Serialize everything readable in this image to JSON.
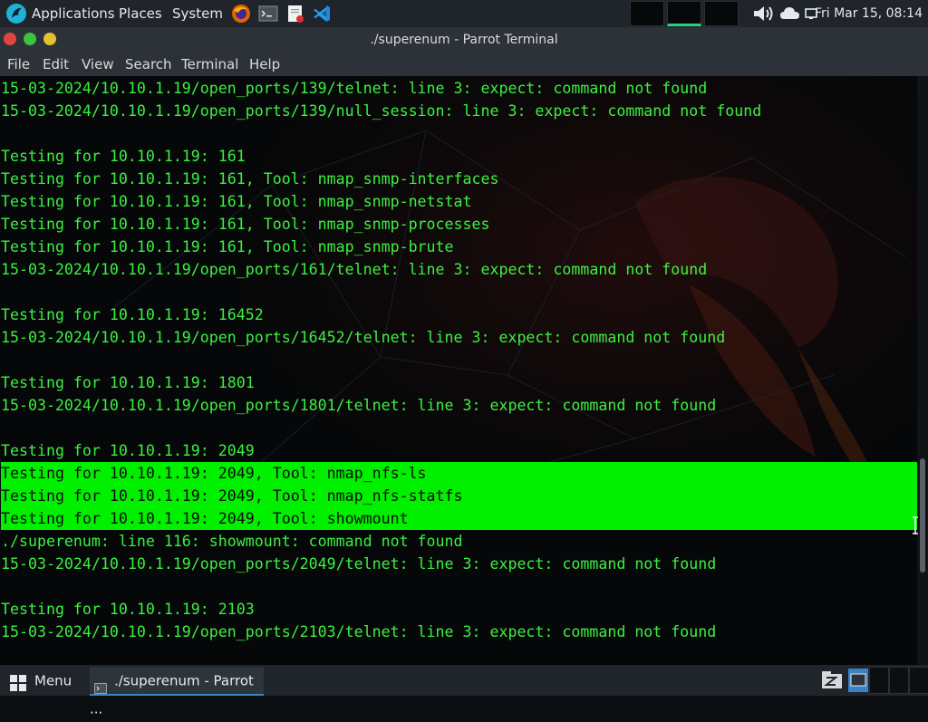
{
  "top_panel": {
    "applications_label": "Applications",
    "places_label": "Places",
    "system_label": "System",
    "launchers": [
      "firefox-icon",
      "terminal-icon",
      "text-editor-icon",
      "vscode-icon"
    ],
    "clock": "Fri Mar 15, 08:14"
  },
  "window": {
    "title": "./superenum - Parrot Terminal",
    "menu": {
      "file": "File",
      "edit": "Edit",
      "view": "View",
      "search": "Search",
      "terminal": "Terminal",
      "help": "Help"
    }
  },
  "terminal": {
    "text_color": "#3cf040",
    "selection_color": "#00f000",
    "lines": [
      {
        "text": "15-03-2024/10.10.1.19/open_ports/139/telnet: line 3: expect: command not found",
        "selected": false
      },
      {
        "text": "15-03-2024/10.10.1.19/open_ports/139/null_session: line 3: expect: command not found",
        "selected": false
      },
      {
        "text": "",
        "selected": false
      },
      {
        "text": "Testing for 10.10.1.19: 161",
        "selected": false
      },
      {
        "text": "Testing for 10.10.1.19: 161, Tool: nmap_snmp-interfaces",
        "selected": false
      },
      {
        "text": "Testing for 10.10.1.19: 161, Tool: nmap_snmp-netstat",
        "selected": false
      },
      {
        "text": "Testing for 10.10.1.19: 161, Tool: nmap_snmp-processes",
        "selected": false
      },
      {
        "text": "Testing for 10.10.1.19: 161, Tool: nmap_snmp-brute",
        "selected": false
      },
      {
        "text": "15-03-2024/10.10.1.19/open_ports/161/telnet: line 3: expect: command not found",
        "selected": false
      },
      {
        "text": "",
        "selected": false
      },
      {
        "text": "Testing for 10.10.1.19: 16452",
        "selected": false
      },
      {
        "text": "15-03-2024/10.10.1.19/open_ports/16452/telnet: line 3: expect: command not found",
        "selected": false
      },
      {
        "text": "",
        "selected": false
      },
      {
        "text": "Testing for 10.10.1.19: 1801",
        "selected": false
      },
      {
        "text": "15-03-2024/10.10.1.19/open_ports/1801/telnet: line 3: expect: command not found",
        "selected": false
      },
      {
        "text": "",
        "selected": false
      },
      {
        "text": "Testing for 10.10.1.19: 2049",
        "selected": false
      },
      {
        "text": "Testing for 10.10.1.19: 2049, Tool: nmap_nfs-ls",
        "selected": true
      },
      {
        "text": "Testing for 10.10.1.19: 2049, Tool: nmap_nfs-statfs",
        "selected": true
      },
      {
        "text": "Testing for 10.10.1.19: 2049, Tool: showmount",
        "selected": true
      },
      {
        "text": "./superenum: line 116: showmount: command not found",
        "selected": false
      },
      {
        "text": "15-03-2024/10.10.1.19/open_ports/2049/telnet: line 3: expect: command not found",
        "selected": false
      },
      {
        "text": "",
        "selected": false
      },
      {
        "text": "Testing for 10.10.1.19: 2103",
        "selected": false
      },
      {
        "text": "15-03-2024/10.10.1.19/open_ports/2103/telnet: line 3: expect: command not found",
        "selected": false
      }
    ]
  },
  "bottom_panel": {
    "menu_label": "Menu",
    "task_label": "./superenum - Parrot ..."
  }
}
